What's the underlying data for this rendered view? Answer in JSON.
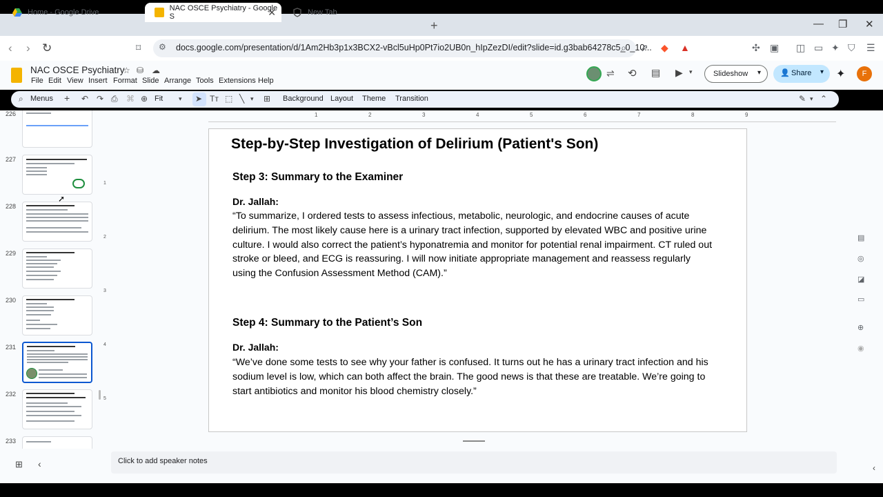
{
  "browser": {
    "tabs": [
      {
        "title": "Home - Google Drive"
      },
      {
        "title": "NAC OSCE Psychiatry - Google S"
      },
      {
        "title": "New Tab"
      }
    ],
    "url": "docs.google.com/presentation/d/1Am2Hb3p1x3BCX2-vBcl5uHp0Pt7io2UB0n_hIpZezDI/edit?slide=id.g3bab64278c5_0_10..."
  },
  "app": {
    "doc_title": "NAC OSCE Psychiatry",
    "menus": [
      "File",
      "Edit",
      "View",
      "Insert",
      "Format",
      "Slide",
      "Arrange",
      "Tools",
      "Extensions",
      "Help"
    ],
    "slideshow_label": "Slideshow",
    "share_label": "Share",
    "avatar_letter": "F"
  },
  "toolbar": {
    "menus_label": "Menus",
    "zoom": "Fit",
    "background": "Background",
    "layout": "Layout",
    "theme": "Theme",
    "transition": "Transition"
  },
  "filmstrip": {
    "slides": [
      {
        "num": "226"
      },
      {
        "num": "227"
      },
      {
        "num": "228"
      },
      {
        "num": "229"
      },
      {
        "num": "230"
      },
      {
        "num": "231",
        "selected": true
      },
      {
        "num": "232"
      },
      {
        "num": "233"
      }
    ]
  },
  "ruler": {
    "h": [
      "1",
      "2",
      "3",
      "4",
      "5",
      "6",
      "7",
      "8",
      "9"
    ],
    "v": [
      "1",
      "2",
      "3",
      "4",
      "5"
    ]
  },
  "slide": {
    "title": "Step-by-Step Investigation of Delirium (Patient's Son)",
    "step3_heading": "Step 3: Summary to the Examiner",
    "step3_speaker": "Dr. Jallah:",
    "step3_quote": " “To summarize, I ordered tests to assess infectious, metabolic, neurologic, and endocrine causes of acute delirium. The most likely cause here is a urinary tract infection, supported by elevated WBC and positive urine culture. I would also correct the patient’s hyponatremia and monitor for potential renal impairment. CT ruled out stroke or bleed, and ECG is reassuring. I will now initiate appropriate management and reassess regularly using the Confusion Assessment Method (CAM).”",
    "step4_heading": "Step 4: Summary to the Patient’s Son",
    "step4_speaker": "Dr. Jallah:",
    "step4_quote": " “We’ve done some tests to see why your father is confused. It turns out he has a urinary tract infection and his sodium level is low, which can both affect the brain. The good news is that these are treatable. We’re going to start antibiotics and monitor his blood chemistry closely.”"
  },
  "notes_placeholder": "Click to add speaker notes"
}
